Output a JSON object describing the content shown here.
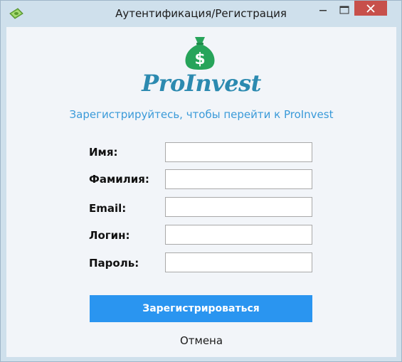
{
  "window": {
    "title": "Аутентификация/Регистрация",
    "icon": "money-app-icon"
  },
  "logo": {
    "icon": "money-bag-icon",
    "symbol": "$",
    "text": "ProInvest",
    "color": "#2c8ab0",
    "bag_color": "#27a45a"
  },
  "form": {
    "subtitle": "Зарегистрируйтесь, чтобы перейти к ProInvest",
    "fields": [
      {
        "label": "Имя:",
        "value": ""
      },
      {
        "label": "Фамилия:",
        "value": ""
      },
      {
        "label": "Email:",
        "value": ""
      },
      {
        "label": "Логин:",
        "value": ""
      },
      {
        "label": "Пароль:",
        "value": ""
      }
    ],
    "submit_label": "Зарегистрироваться",
    "cancel_label": "Отмена"
  },
  "colors": {
    "accent": "#2a95f0",
    "subtitle": "#3a9ad9",
    "close_button": "#c7504b"
  }
}
